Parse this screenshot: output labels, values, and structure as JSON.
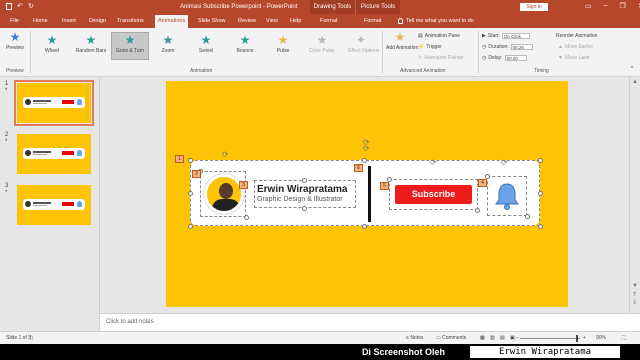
{
  "window": {
    "title": "Animasi Subscribe Powerpoint  -  PowerPoint",
    "context_tab1": "Drawing Tools",
    "context_tab2": "Picture Tools",
    "signin": "Sign in"
  },
  "tabs": [
    "File",
    "Home",
    "Insert",
    "Design",
    "Transitions",
    "Animations",
    "Slide Show",
    "Review",
    "View",
    "Help",
    "Format",
    "Format"
  ],
  "tell_me": "Tell me what you want to do",
  "ribbon": {
    "preview": {
      "label": "Preview",
      "group": "Preview"
    },
    "animation_gallery": [
      "Wheel",
      "Random Bars",
      "Grow & Turn",
      "Zoom",
      "Swivel",
      "Bounce",
      "Pulse",
      "Color Pulse"
    ],
    "effect_options": "Effect Options",
    "animation_group": "Animation",
    "add_animation": "Add Animation",
    "animation_pane": "Animation Pane",
    "trigger": "Trigger",
    "animation_painter": "Animation Painter",
    "advanced_group": "Advanced Animation",
    "start_label": "Start:",
    "start_value": "On Click",
    "duration_label": "Duration:",
    "duration_value": "00.25",
    "delay_label": "Delay:",
    "delay_value": "00.00",
    "reorder": "Reorder Animation",
    "move_earlier": "Move Earlier",
    "move_later": "Move Later",
    "timing_group": "Timing"
  },
  "slides": [
    {
      "num": "1",
      "star": "*"
    },
    {
      "num": "2",
      "star": "*"
    },
    {
      "num": "3",
      "star": "*"
    }
  ],
  "slide": {
    "name": "Erwin Wirapratama",
    "subtitle": "Graphic Design & Illustrator",
    "subscribe": "Subscribe",
    "tags": [
      "1",
      "2",
      "3",
      "4",
      "5",
      "6"
    ]
  },
  "notes_placeholder": "Click to add notes",
  "status": {
    "slide_info": "Slide 1 of 3",
    "notes": "Notes",
    "comments": "Comments",
    "zoom": "90%"
  },
  "banner": {
    "label": "Di Screenshot Oleh",
    "name": "Erwin Wirapratama"
  },
  "colors": {
    "accent": "#b7472a",
    "slide_bg": "#fdc305",
    "subscribe": "#ee1b1b",
    "bell": "#6aa3e8"
  }
}
